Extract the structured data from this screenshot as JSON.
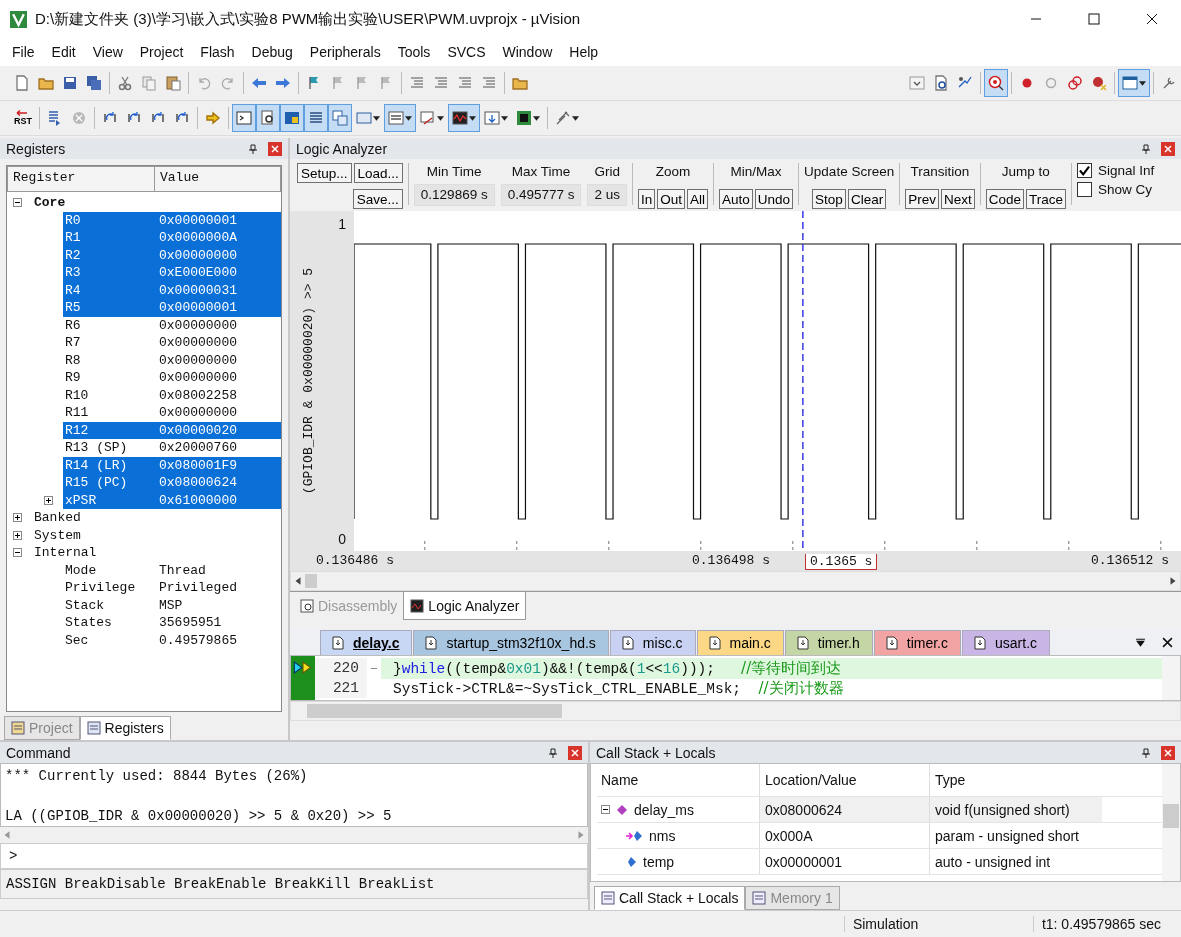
{
  "window": {
    "title": "D:\\新建文件夹 (3)\\学习\\嵌入式\\实验8 PWM输出实验\\USER\\PWM.uvprojx - µVision"
  },
  "menu": [
    "File",
    "Edit",
    "View",
    "Project",
    "Flash",
    "Debug",
    "Peripherals",
    "Tools",
    "SVCS",
    "Window",
    "Help"
  ],
  "toolbar_1": {
    "pressed": [
      false,
      false,
      false,
      false,
      false,
      false,
      false,
      false,
      false,
      false,
      false,
      false,
      false,
      false,
      false,
      false,
      false,
      false,
      false,
      false,
      false,
      false,
      false,
      true,
      false,
      false,
      false,
      false,
      true,
      false
    ]
  },
  "toolbar_2": {
    "reset_label": "RST",
    "pressed": [
      false,
      false,
      false,
      false,
      false,
      false,
      false,
      false,
      true,
      true,
      true,
      true,
      true,
      false,
      true,
      false,
      true,
      false,
      false,
      false
    ]
  },
  "registers_panel": {
    "title": "Registers",
    "columns": [
      "Register",
      "Value"
    ],
    "tree": [
      {
        "name": "Core",
        "expanded": true,
        "children": [
          {
            "name": "R0",
            "value": "0x00000001",
            "selected": true
          },
          {
            "name": "R1",
            "value": "0x0000000A",
            "selected": true
          },
          {
            "name": "R2",
            "value": "0x00000000",
            "selected": true
          },
          {
            "name": "R3",
            "value": "0xE000E000",
            "selected": true
          },
          {
            "name": "R4",
            "value": "0x00000031",
            "selected": true
          },
          {
            "name": "R5",
            "value": "0x00000001",
            "selected": true
          },
          {
            "name": "R6",
            "value": "0x00000000",
            "selected": false
          },
          {
            "name": "R7",
            "value": "0x00000000",
            "selected": false
          },
          {
            "name": "R8",
            "value": "0x00000000",
            "selected": false
          },
          {
            "name": "R9",
            "value": "0x00000000",
            "selected": false
          },
          {
            "name": "R10",
            "value": "0x08002258",
            "selected": false
          },
          {
            "name": "R11",
            "value": "0x00000000",
            "selected": false
          },
          {
            "name": "R12",
            "value": "0x00000020",
            "selected": true
          },
          {
            "name": "R13 (SP)",
            "value": "0x20000760",
            "selected": false
          },
          {
            "name": "R14 (LR)",
            "value": "0x080001F9",
            "selected": true
          },
          {
            "name": "R15 (PC)",
            "value": "0x08000624",
            "selected": true
          },
          {
            "name": "xPSR",
            "value": "0x61000000",
            "selected": true,
            "expanded": false
          }
        ]
      },
      {
        "name": "Banked",
        "expanded": false
      },
      {
        "name": "System",
        "expanded": false
      },
      {
        "name": "Internal",
        "expanded": true,
        "children": [
          {
            "name": "Mode",
            "value": "Thread",
            "selected": false
          },
          {
            "name": "Privilege",
            "value": "Privileged",
            "selected": false
          },
          {
            "name": "Stack",
            "value": "MSP",
            "selected": false
          },
          {
            "name": "States",
            "value": "35695951",
            "selected": false
          },
          {
            "name": "Sec",
            "value": "0.49579865",
            "selected": false
          }
        ]
      }
    ],
    "tabs": [
      {
        "label": "Project",
        "selected": false
      },
      {
        "label": "Registers",
        "selected": true
      }
    ]
  },
  "logic_analyzer": {
    "title": "Logic Analyzer",
    "setup": "Setup...",
    "load": "Load...",
    "save": "Save...",
    "groups": [
      {
        "kind": "readout",
        "label": "Min Time",
        "value": "0.129869 s"
      },
      {
        "kind": "readout",
        "label": "Max Time",
        "value": "0.495777 s"
      },
      {
        "kind": "readout",
        "label": "Grid",
        "value": "2 us"
      },
      {
        "kind": "buttons",
        "label": "Zoom",
        "buttons": [
          "In",
          "Out",
          "All"
        ]
      },
      {
        "kind": "buttons",
        "label": "Min/Max",
        "buttons": [
          "Auto",
          "Undo"
        ]
      },
      {
        "kind": "buttons",
        "label": "Update Screen",
        "buttons": [
          "Stop",
          "Clear"
        ]
      },
      {
        "kind": "buttons",
        "label": "Transition",
        "buttons": [
          "Prev",
          "Next"
        ]
      },
      {
        "kind": "buttons",
        "label": "Jump to",
        "buttons": [
          "Code",
          "Trace"
        ]
      }
    ],
    "checkboxes": [
      {
        "label": "Signal Inf",
        "checked": true
      },
      {
        "label": "Show Cy",
        "checked": false
      }
    ],
    "signal": {
      "name": "(GPIOB_IDR & 0x00000020) >> 5",
      "high_label": "1",
      "low_label": "0"
    },
    "time_labels": [
      "0.136486 s",
      "0.136498 s",
      "0.136512 s"
    ],
    "cursor_label": "0.1365 s",
    "view_tabs": [
      {
        "label": "Disassembly",
        "selected": false
      },
      {
        "label": "Logic Analyzer",
        "selected": true
      }
    ]
  },
  "editor": {
    "tabs": [
      {
        "label": "delay.c",
        "color": "#c8d8f4",
        "selected": true
      },
      {
        "label": "startup_stm32f10x_hd.s",
        "color": "#a8c6df",
        "selected": false
      },
      {
        "label": "misc.c",
        "color": "#c9d2f3",
        "selected": false
      },
      {
        "label": "main.c",
        "color": "#fcd886",
        "selected": false
      },
      {
        "label": "timer.h",
        "color": "#c5d6a6",
        "selected": false
      },
      {
        "label": "timer.c",
        "color": "#f2a3a3",
        "selected": false
      },
      {
        "label": "usart.c",
        "color": "#c9b5e6",
        "selected": false
      }
    ],
    "lines": [
      {
        "number": "220",
        "current": true,
        "segments": [
          {
            "kind": "plain",
            "text": "}"
          },
          {
            "kind": "keyword",
            "text": "while"
          },
          {
            "kind": "plain",
            "text": "((temp&"
          },
          {
            "kind": "number",
            "text": "0x01"
          },
          {
            "kind": "plain",
            "text": ")&&!(temp&("
          },
          {
            "kind": "number",
            "text": "1"
          },
          {
            "kind": "plain",
            "text": "<<"
          },
          {
            "kind": "number",
            "text": "16"
          },
          {
            "kind": "plain",
            "text": ")));   "
          },
          {
            "kind": "comment",
            "text": "//等待时间到达"
          }
        ]
      },
      {
        "number": "221",
        "current": false,
        "segments": [
          {
            "kind": "plain",
            "text": "SysTick->CTRL&=~SysTick_CTRL_ENABLE_Msk;  "
          },
          {
            "kind": "comment",
            "text": "//关闭计数器"
          }
        ]
      }
    ]
  },
  "command": {
    "title": "Command",
    "output": [
      "*** Currently used: 8844 Bytes (26%)",
      "LA ((GPIOB_IDR & 0x00000020) >> 5 & 0x20) >> 5"
    ],
    "prompt": ">",
    "hint": "ASSIGN BreakDisable BreakEnable BreakKill BreakList"
  },
  "call_stack": {
    "title": "Call Stack + Locals",
    "columns": [
      "Name",
      "Location/Value",
      "Type"
    ],
    "rows": [
      {
        "name": "delay_ms",
        "value": "0x08000624",
        "type": "void f(unsigned short)",
        "kind": "function",
        "expanded": true,
        "children": [
          {
            "name": "nms",
            "value": "0x000A",
            "type": "param - unsigned short",
            "kind": "param"
          },
          {
            "name": "temp",
            "value": "0x00000001",
            "type": "auto - unsigned int",
            "kind": "auto"
          }
        ]
      }
    ],
    "tabs": [
      {
        "label": "Call Stack + Locals",
        "selected": true
      },
      {
        "label": "Memory 1",
        "selected": false
      }
    ]
  },
  "status_bar": {
    "mode": "Simulation",
    "time": "t1: 0.49579865 sec"
  }
}
